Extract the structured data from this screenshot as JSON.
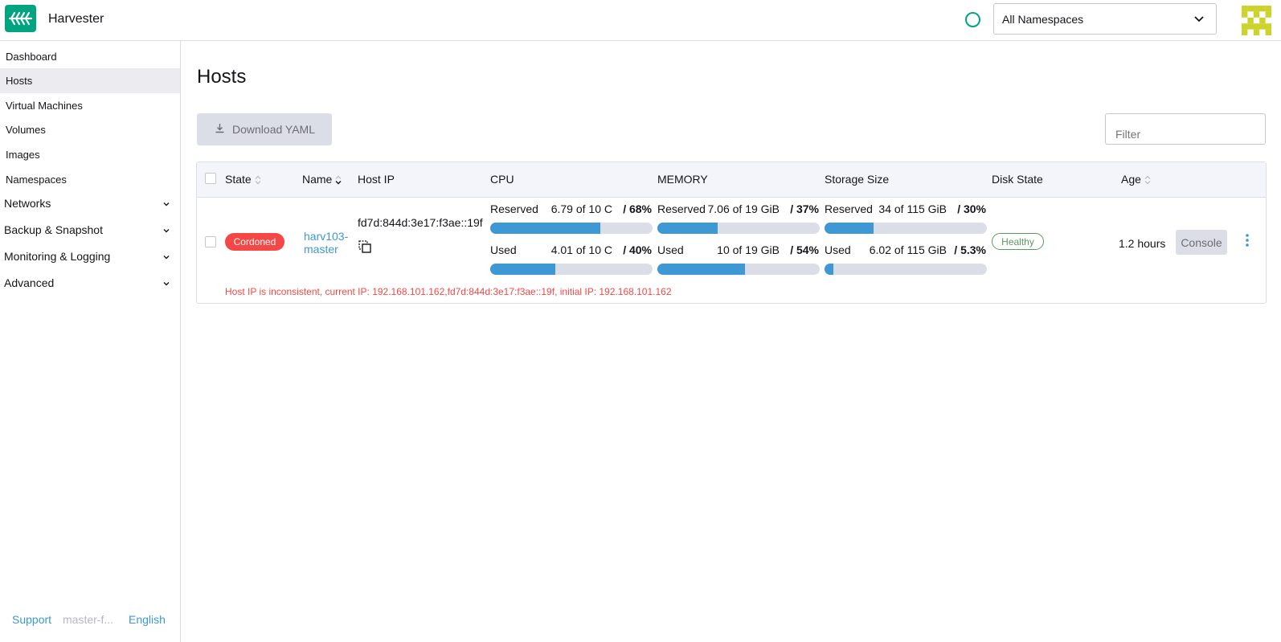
{
  "header": {
    "app_title": "Harvester",
    "namespace_select": "All Namespaces"
  },
  "sidebar": {
    "items": [
      {
        "label": "Dashboard"
      },
      {
        "label": "Hosts",
        "active": true
      },
      {
        "label": "Virtual Machines"
      },
      {
        "label": "Volumes"
      },
      {
        "label": "Images"
      },
      {
        "label": "Namespaces"
      }
    ],
    "groups": [
      {
        "label": "Networks"
      },
      {
        "label": "Backup & Snapshot"
      },
      {
        "label": "Monitoring & Logging"
      },
      {
        "label": "Advanced"
      }
    ],
    "footer": {
      "support": "Support",
      "version": "master-f...",
      "language": "English"
    }
  },
  "main": {
    "title": "Hosts",
    "download_label": "Download YAML",
    "filter_placeholder": "Filter",
    "columns": [
      "State",
      "Name",
      "Host IP",
      "CPU",
      "MEMORY",
      "Storage Size",
      "Disk State",
      "Age"
    ],
    "rows": [
      {
        "state": "Cordoned",
        "name": "harv103-master",
        "host_ip": "fd7d:844d:3e17:f3ae::19f",
        "cpu": {
          "reserved_label": "Reserved",
          "reserved_value": "6.79 of 10 C",
          "reserved_pct": "/ 68%",
          "reserved_fraction": 0.68,
          "used_label": "Used",
          "used_value": "4.01 of 10 C",
          "used_pct": "/ 40%",
          "used_fraction": 0.4
        },
        "memory": {
          "reserved_label": "Reserved",
          "reserved_value": "7.06 of 19 GiB",
          "reserved_pct": "/ 37%",
          "reserved_fraction": 0.37,
          "used_label": "Used",
          "used_value": "10 of 19 GiB",
          "used_pct": "/ 54%",
          "used_fraction": 0.54
        },
        "storage": {
          "reserved_label": "Reserved",
          "reserved_value": "34 of 115 GiB",
          "reserved_pct": "/ 30%",
          "reserved_fraction": 0.3,
          "used_label": "Used",
          "used_value": "6.02 of 115 GiB",
          "used_pct": "/ 5.3%",
          "used_fraction": 0.053
        },
        "disk_state": "Healthy",
        "age": "1.2 hours",
        "console_label": "Console",
        "warning": "Host IP is inconsistent, current IP: 192.168.101.162,fd7d:844d:3e17:f3ae::19f, initial IP: 192.168.101.162"
      }
    ]
  },
  "colors": {
    "brand": "#00a580",
    "link": "#3d98d3",
    "error": "#f64747",
    "success": "#5d995d"
  },
  "icons": [
    "harvester-logo-icon",
    "status-ring-icon",
    "chevron-down-icon",
    "user-avatar-icon",
    "download-icon",
    "sort-icon",
    "copy-icon",
    "kebab-menu-icon"
  ]
}
